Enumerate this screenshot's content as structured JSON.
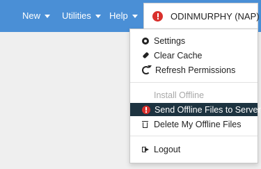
{
  "nav": {
    "new_label": "New",
    "utilities_label": "Utilities",
    "help_label": "Help",
    "user_label": "ODINMURPHY (NAP)"
  },
  "menu": {
    "settings": "Settings",
    "clear_cache": "Clear Cache",
    "refresh_permissions": "Refresh Permissions",
    "install_offline": "Install Offline",
    "send_offline_files": "Send Offline Files to Server",
    "delete_offline_files": "Delete My Offline Files",
    "logout": "Logout"
  },
  "icons": {
    "settings": "gear-icon",
    "clear_cache": "eraser-icon",
    "refresh_permissions": "refresh-icon",
    "send_offline_files": "alert-icon",
    "delete_offline_files": "trash-icon",
    "logout": "logout-icon",
    "user": "alert-icon"
  },
  "colors": {
    "navbar": "#4a8fd6",
    "alert": "#d9302c",
    "active_item": "#1d3340",
    "disabled_text": "#a8a8a8"
  }
}
